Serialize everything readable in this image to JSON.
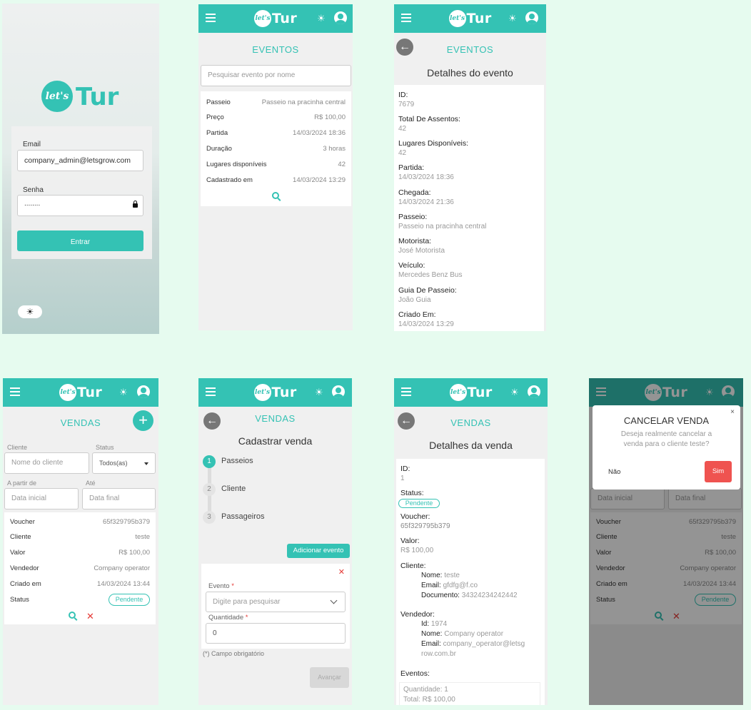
{
  "login": {
    "logo_lets": "let's",
    "logo_tur": "Tur",
    "email_label": "Email",
    "email_value": "company_admin@letsgrow.com",
    "password_label": "Senha",
    "password_value": "........",
    "submit_label": "Entrar"
  },
  "header": {
    "logo_lets": "let's",
    "logo_tur": "Tur",
    "sun_glyph": "☀",
    "back_glyph": "←"
  },
  "events_list": {
    "title": "EVENTOS",
    "search_placeholder": "Pesquisar evento por nome",
    "rows": [
      {
        "label": "Passeio",
        "value": "Passeio na pracinha central"
      },
      {
        "label": "Preço",
        "value": "R$ 100,00"
      },
      {
        "label": "Partida",
        "value": "14/03/2024 18:36"
      },
      {
        "label": "Duração",
        "value": "3 horas"
      },
      {
        "label": "Lugares disponíveis",
        "value": "42"
      },
      {
        "label": "Cadastrado em",
        "value": "14/03/2024 13:29"
      }
    ]
  },
  "event_detail": {
    "title": "EVENTOS",
    "subtitle": "Detalhes do evento",
    "fields": [
      {
        "label": "ID:",
        "value": "7679"
      },
      {
        "label": "Total De Assentos:",
        "value": "42"
      },
      {
        "label": "Lugares Disponíveis:",
        "value": "42"
      },
      {
        "label": "Partida:",
        "value": "14/03/2024 18:36"
      },
      {
        "label": "Chegada:",
        "value": "14/03/2024 21:36"
      },
      {
        "label": "Passeio:",
        "value": "Passeio na pracinha central"
      },
      {
        "label": "Motorista:",
        "value": "José Motorista"
      },
      {
        "label": "Veículo:",
        "value": "Mercedes Benz Bus"
      },
      {
        "label": "Guia De Passeio:",
        "value": "João Guia"
      },
      {
        "label": "Criado Em:",
        "value": "14/03/2024 13:29"
      }
    ]
  },
  "sales_list": {
    "title": "VENDAS",
    "add_glyph": "+",
    "client_label": "Cliente",
    "client_placeholder": "Nome do cliente",
    "status_label": "Status",
    "status_value": "Todos(as)",
    "from_label": "A partir de",
    "from_placeholder": "Data inicial",
    "to_label": "Até",
    "to_placeholder": "Data final",
    "rows": [
      {
        "label": "Voucher",
        "value": "65f329795b379"
      },
      {
        "label": "Cliente",
        "value": "teste"
      },
      {
        "label": "Valor",
        "value": "R$ 100,00"
      },
      {
        "label": "Vendedor",
        "value": "Company operator"
      },
      {
        "label": "Criado em",
        "value": "14/03/2024 13:44"
      }
    ],
    "status_row_label": "Status",
    "status_badge": "Pendente"
  },
  "sale_create": {
    "title": "VENDAS",
    "subtitle": "Cadastrar venda",
    "steps": [
      {
        "num": "1",
        "label": "Passeios"
      },
      {
        "num": "2",
        "label": "Cliente"
      },
      {
        "num": "3",
        "label": "Passageiros"
      }
    ],
    "add_event_label": "Adicionar evento",
    "event_label": "Evento",
    "event_placeholder": "Digite para pesquisar",
    "quantity_label": "Quantidade",
    "quantity_value": "0",
    "required_mark": "*",
    "required_note": "(*) Campo obrigatório",
    "next_label": "Avançar"
  },
  "sale_detail": {
    "title": "VENDAS",
    "subtitle": "Detalhes da venda",
    "id_label": "ID:",
    "id_value": "1",
    "status_label": "Status:",
    "status_value": "Pendente",
    "voucher_label": "Voucher:",
    "voucher_value": "65f329795b379",
    "valor_label": "Valor:",
    "valor_value": "R$ 100,00",
    "cliente_label": "Cliente:",
    "cliente_nome_key": "Nome:",
    "cliente_nome": "teste",
    "cliente_email_key": "Email:",
    "cliente_email": "gfdfg@f.co",
    "cliente_doc_key": "Documento:",
    "cliente_doc": "34324234242442",
    "vendedor_label": "Vendedor:",
    "vendedor_id_key": "Id:",
    "vendedor_id": "1974",
    "vendedor_nome_key": "Nome:",
    "vendedor_nome": "Company operator",
    "vendedor_email_key": "Email:",
    "vendedor_email_1": "company_operator@letsg",
    "vendedor_email_2": "row.com.br",
    "eventos_label": "Eventos:",
    "eventos_qty": "Quantidade: 1",
    "eventos_total": "Total: R$ 100,00"
  },
  "cancel_modal": {
    "title": "CANCELAR VENDA",
    "message_1": "Deseja realmente cancelar a",
    "message_2": "venda para o cliente teste?",
    "close_glyph": "×",
    "no_label": "Não",
    "yes_label": "Sim",
    "bg_from_placeholder": "Data inicial",
    "bg_to_placeholder": "Data final",
    "bg_rows": [
      {
        "label": "Voucher",
        "value": "65f329795b379"
      },
      {
        "label": "Cliente",
        "value": "teste"
      },
      {
        "label": "Valor",
        "value": "R$ 100,00"
      },
      {
        "label": "Vendedor",
        "value": "Company operator"
      },
      {
        "label": "Criado em",
        "value": "14/03/2024 13:44"
      }
    ],
    "bg_status_label": "Status",
    "bg_status_badge": "Pendente"
  }
}
